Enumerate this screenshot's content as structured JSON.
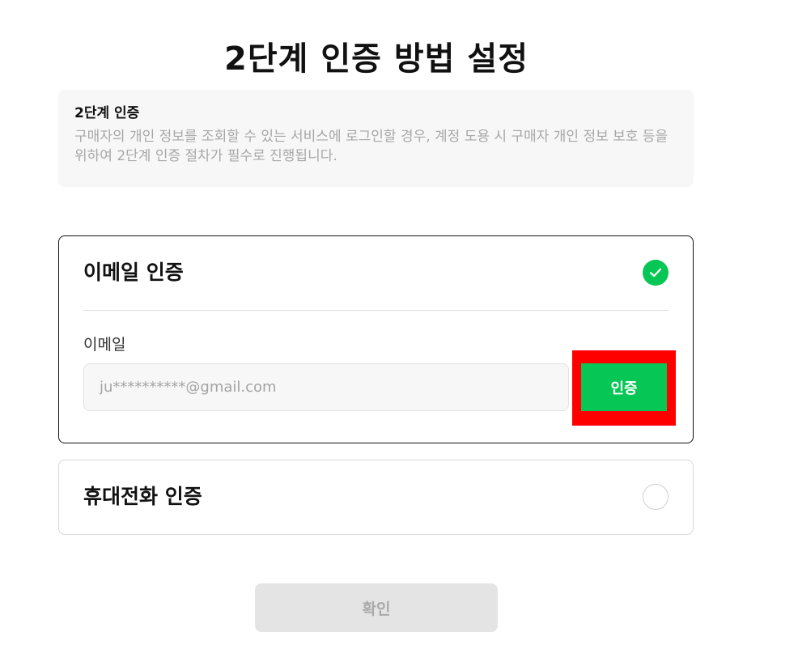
{
  "page": {
    "title": "2단계 인증 방법 설정"
  },
  "info": {
    "title": "2단계 인증",
    "description": "구매자의 개인 정보를 조회할 수 있는 서비스에 로그인할 경우, 계정 도용 시 구매자 개인 정보 보호 등을 위하여 2단계 인증 절차가 필수로 진행됩니다."
  },
  "email_method": {
    "title": "이메일 인증",
    "selected": true,
    "field_label": "이메일",
    "email_value": "ju**********@gmail.com",
    "verify_label": "인증"
  },
  "phone_method": {
    "title": "휴대전화 인증",
    "selected": false
  },
  "actions": {
    "confirm_label": "확인"
  },
  "colors": {
    "accent": "#06c755",
    "highlight": "#ff0000",
    "disabled": "#e4e4e4"
  },
  "icons": {
    "email_radio": "check-circle-icon",
    "phone_radio": "empty-circle-icon"
  }
}
